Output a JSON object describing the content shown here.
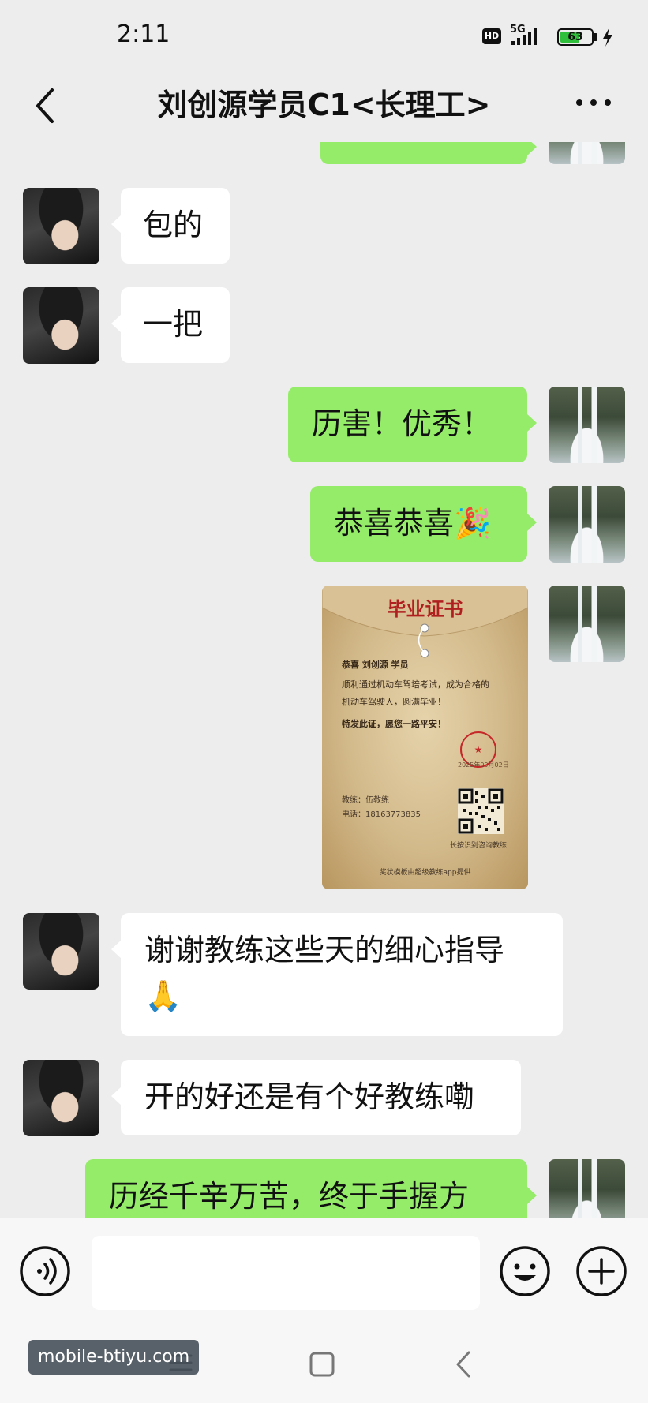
{
  "status_bar": {
    "time": "2:11",
    "hd": "HD",
    "network": "5G",
    "battery": "63",
    "battery_level": 0.63
  },
  "header": {
    "title": "刘创源学员C1<长理工>"
  },
  "messages": [
    {
      "side": "in",
      "text": "包的"
    },
    {
      "side": "in",
      "text": "一把"
    },
    {
      "side": "out",
      "text": "历害！优秀！"
    },
    {
      "side": "out",
      "text": "恭喜恭喜",
      "emoji": "🎉"
    },
    {
      "side": "out",
      "type": "image"
    },
    {
      "side": "in",
      "text": "谢谢教练这些天的细心指导",
      "emoji": "🙏"
    },
    {
      "side": "in",
      "text": "开的好还是有个好教练嘞"
    },
    {
      "side": "out",
      "text": "历经千辛万苦，终于手握方"
    }
  ],
  "certificate": {
    "title": "毕业证书",
    "line1": "恭喜  刘创源 学员",
    "line2": "顺利通过机动车驾培考试，成为合格的",
    "line3": "机动车驾驶人，圆满毕业！",
    "line4": "特发此证，愿您一路平安！",
    "stamp_date": "2025年09月02日",
    "coach": "教练：伍教练",
    "phone": "电话：18163773835",
    "qr_hint": "长按识别咨询教练",
    "footer": "奖状模板由超级教练app提供"
  },
  "input_bar": {
    "placeholder": ""
  },
  "watermark": "mobile-btiyu.com",
  "colors": {
    "background": "#ededed",
    "outgoing_bubble": "#95ec69",
    "incoming_bubble": "#ffffff",
    "certificate_red": "#b01f1f"
  }
}
